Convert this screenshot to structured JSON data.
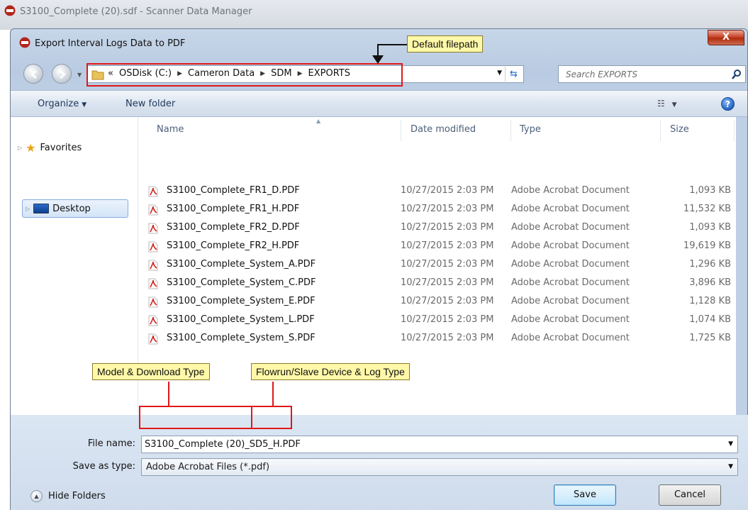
{
  "parent_window": {
    "title": "S3100_Complete (20).sdf - Scanner Data Manager"
  },
  "dialog": {
    "title": "Export Interval Logs Data to PDF",
    "close_label": "X"
  },
  "address_bar": {
    "overflow": "«",
    "crumbs": [
      "OSDisk (C:)",
      "Cameron Data",
      "SDM",
      "EXPORTS"
    ],
    "search_placeholder": "Search EXPORTS"
  },
  "toolbar": {
    "organize_label": "Organize",
    "new_folder_label": "New folder",
    "help_label": "?"
  },
  "nav_pane": {
    "favorites_label": "Favorites",
    "desktop_label": "Desktop"
  },
  "columns": {
    "name": "Name",
    "date_modified": "Date modified",
    "type": "Type",
    "size": "Size"
  },
  "files": [
    {
      "name": "S3100_Complete_FR1_D.PDF",
      "date": "10/27/2015 2:03 PM",
      "type": "Adobe Acrobat Document",
      "size": "1,093 KB"
    },
    {
      "name": "S3100_Complete_FR1_H.PDF",
      "date": "10/27/2015 2:03 PM",
      "type": "Adobe Acrobat Document",
      "size": "11,532 KB"
    },
    {
      "name": "S3100_Complete_FR2_D.PDF",
      "date": "10/27/2015 2:03 PM",
      "type": "Adobe Acrobat Document",
      "size": "1,093 KB"
    },
    {
      "name": "S3100_Complete_FR2_H.PDF",
      "date": "10/27/2015 2:03 PM",
      "type": "Adobe Acrobat Document",
      "size": "19,619 KB"
    },
    {
      "name": "S3100_Complete_System_A.PDF",
      "date": "10/27/2015 2:03 PM",
      "type": "Adobe Acrobat Document",
      "size": "1,296 KB"
    },
    {
      "name": "S3100_Complete_System_C.PDF",
      "date": "10/27/2015 2:03 PM",
      "type": "Adobe Acrobat Document",
      "size": "3,896 KB"
    },
    {
      "name": "S3100_Complete_System_E.PDF",
      "date": "10/27/2015 2:03 PM",
      "type": "Adobe Acrobat Document",
      "size": "1,128 KB"
    },
    {
      "name": "S3100_Complete_System_L.PDF",
      "date": "10/27/2015 2:03 PM",
      "type": "Adobe Acrobat Document",
      "size": "1,074 KB"
    },
    {
      "name": "S3100_Complete_System_S.PDF",
      "date": "10/27/2015 2:03 PM",
      "type": "Adobe Acrobat Document",
      "size": "1,725 KB"
    }
  ],
  "form": {
    "file_name_label": "File name:",
    "file_name_value": "S3100_Complete (20)_SD5_H.PDF",
    "save_as_type_label": "Save as type:",
    "save_as_type_value": "Adobe Acrobat Files (*.pdf)"
  },
  "footer": {
    "hide_folders_label": "Hide Folders",
    "save_label": "Save",
    "cancel_label": "Cancel"
  },
  "annotations": {
    "default_filepath": "Default filepath",
    "model_download_type": "Model & Download Type",
    "flowrun_log_type": "Flowrun/Slave Device & Log Type"
  },
  "colors": {
    "annotation_red": "#e01818",
    "callout_yellow": "#fff8a8",
    "dialog_chrome": "#c7d6e9"
  }
}
